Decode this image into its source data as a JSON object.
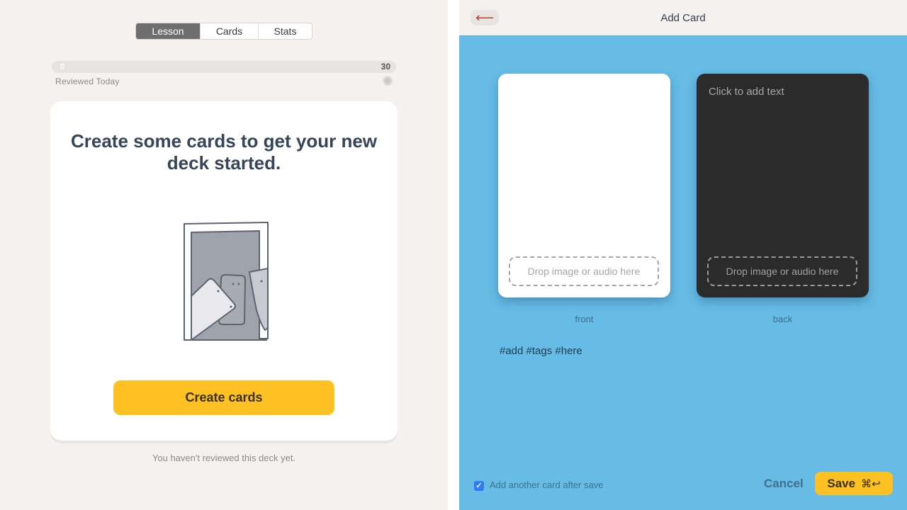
{
  "lesson_panel": {
    "tabs": [
      {
        "label": "Lesson",
        "active": true
      },
      {
        "label": "Cards",
        "active": false
      },
      {
        "label": "Stats",
        "active": false
      }
    ],
    "progress": {
      "current": "0",
      "goal": "30",
      "fraction": 0,
      "label": "Reviewed Today"
    },
    "settings_icon": "gear-icon",
    "empty_state": {
      "headline": "Create some cards to get your new deck started.",
      "illustration": "empty-deck-illustration",
      "button_label": "Create cards"
    },
    "footer_text": "You haven't reviewed this deck yet.",
    "accent_color": "#fdc123"
  },
  "add_card_panel": {
    "title": "Add Card",
    "back_icon": "arrow-left-icon",
    "front": {
      "text": "",
      "drop_label": "Drop image or audio here",
      "label": "front"
    },
    "back": {
      "placeholder": "Click to add text",
      "drop_label": "Drop image or audio here",
      "label": "back"
    },
    "tags_placeholder": "#add #tags #here",
    "add_another": {
      "label": "Add another card after save",
      "checked": true
    },
    "cancel_label": "Cancel",
    "save_label": "Save",
    "save_shortcut": "⌘↩",
    "background_color": "#66bce5"
  }
}
